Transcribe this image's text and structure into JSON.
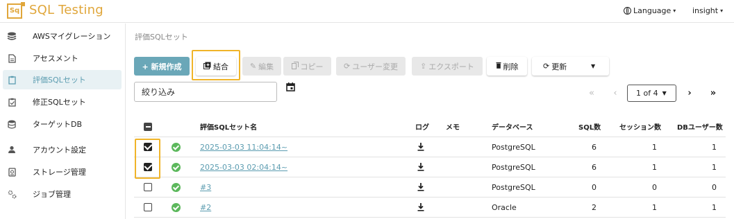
{
  "header": {
    "logo_text": "Sq",
    "app_title": "SQL Testing",
    "language_label": "Language",
    "user_label": "insight"
  },
  "sidebar": {
    "items": [
      {
        "label": "AWSマイグレーション",
        "icon": "database-stack-icon"
      },
      {
        "label": "アセスメント",
        "icon": "document-icon"
      },
      {
        "label": "評価SQLセット",
        "icon": "clipboard-icon",
        "active": true
      },
      {
        "label": "修正SQLセット",
        "icon": "clipboard-check-icon"
      },
      {
        "label": "ターゲットDB",
        "icon": "database-icon"
      },
      {
        "label": "アカウント設定",
        "icon": "person-icon"
      },
      {
        "label": "ストレージ管理",
        "icon": "storage-icon"
      },
      {
        "label": "ジョブ管理",
        "icon": "gears-icon"
      }
    ]
  },
  "breadcrumb": "評価SQLセット",
  "toolbar": {
    "new_label": "+ 新規作成",
    "merge_label": "結合",
    "edit_label": "編集",
    "copy_label": "コピー",
    "user_change_label": "ユーザー変更",
    "export_label": "エクスポート",
    "delete_label": "削除",
    "refresh_label": "更新"
  },
  "filter": {
    "placeholder": "絞り込み"
  },
  "pagination": {
    "page_label": "1 of 4"
  },
  "table": {
    "headers": {
      "name": "評価SQLセット名",
      "log": "ログ",
      "memo": "メモ",
      "database": "データベース",
      "sql_count": "SQL数",
      "session_count": "セッション数",
      "db_user_count": "DBユーザー数"
    },
    "rows": [
      {
        "checked": true,
        "name": "2025-03-03 11:04:14~",
        "database": "PostgreSQL",
        "sql_count": "6",
        "session_count": "1",
        "db_user_count": "1"
      },
      {
        "checked": true,
        "name": "2025-03-03 02:04:14~",
        "database": "PostgreSQL",
        "sql_count": "6",
        "session_count": "1",
        "db_user_count": "1"
      },
      {
        "checked": false,
        "name": "#3",
        "database": "PostgreSQL",
        "sql_count": "0",
        "session_count": "0",
        "db_user_count": "0"
      },
      {
        "checked": false,
        "name": "#2",
        "database": "Oracle",
        "sql_count": "2",
        "session_count": "1",
        "db_user_count": "1"
      }
    ]
  },
  "colors": {
    "brand": "#e0a63a",
    "primary": "#6aa7b8",
    "highlight": "#f0b429",
    "status_ok": "#5cb85c"
  }
}
